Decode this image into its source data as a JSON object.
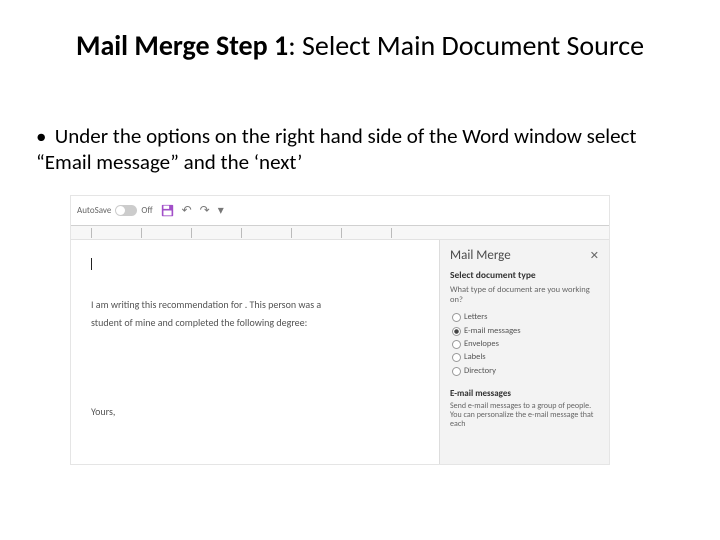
{
  "slide": {
    "title_bold": "Mail Merge Step 1",
    "title_rest": ": Select Main Document Source",
    "bullet": "Under the options on the right hand side of the Word window select “Email message” and the ‘next’"
  },
  "toolbar": {
    "autosave_label": "AutoSave",
    "autosave_state": "Off"
  },
  "document": {
    "line1": "I am writing this recommendation for . This person was a",
    "line2": "student of mine and completed the following degree:",
    "closing": "Yours,"
  },
  "panel": {
    "title": "Mail Merge",
    "section": "Select document type",
    "question": "What type of document are you working on?",
    "options": [
      "Letters",
      "E-mail messages",
      "Envelopes",
      "Labels",
      "Directory"
    ],
    "selected_index": 1,
    "detail_heading": "E-mail messages",
    "detail_text": "Send e-mail messages to a group of people. You can personalize the e-mail message that each"
  }
}
